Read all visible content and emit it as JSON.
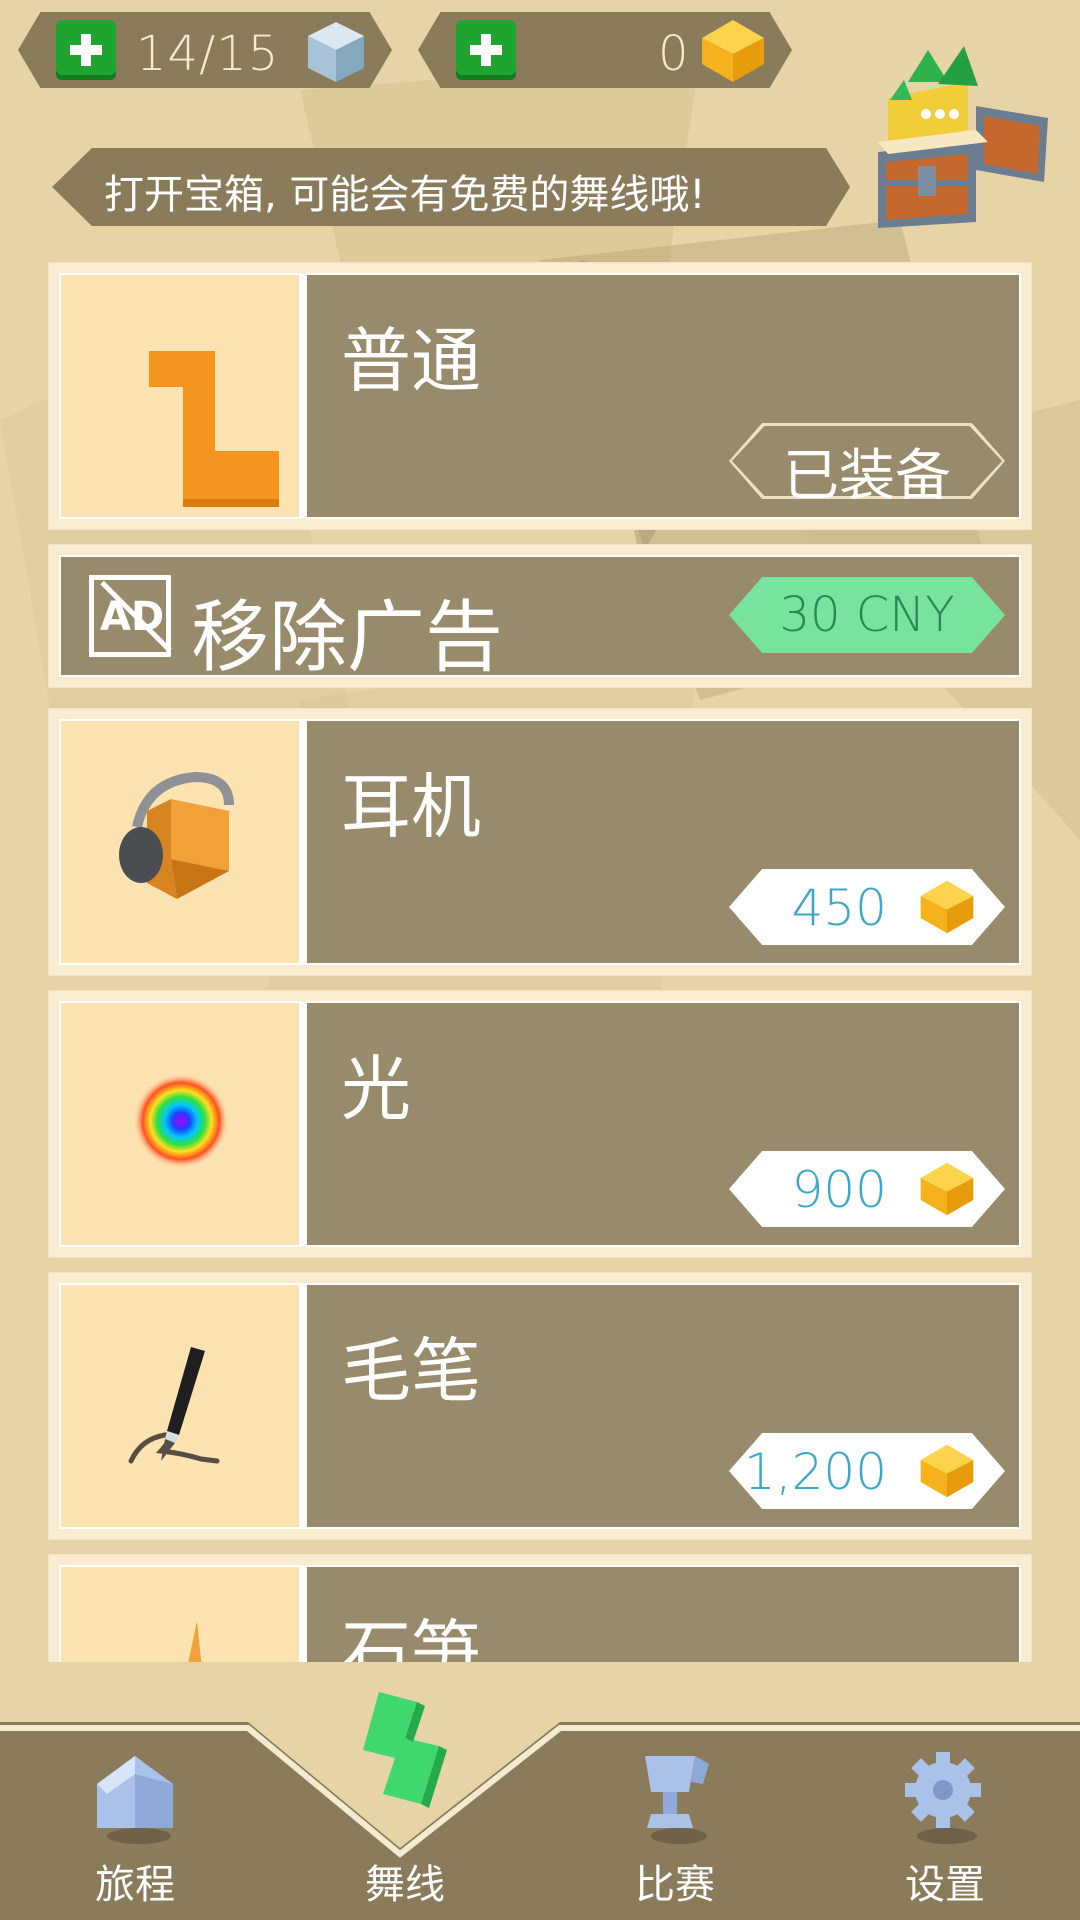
{
  "hud": {
    "lives": {
      "value": "14/15",
      "add_label": "+",
      "icon": "cube-icon"
    },
    "gems": {
      "value": "0",
      "add_label": "+",
      "icon": "gem-icon"
    }
  },
  "banner": {
    "text": "打开宝箱, 可能会有免费的舞线哦!",
    "icon": "treasure-chest-icon"
  },
  "items": [
    {
      "title": "普通",
      "status": "已装备",
      "icon": "orange-line-icon"
    },
    {
      "title": "耳机",
      "price": "450",
      "icon": "headphone-cube-icon"
    },
    {
      "title": "光",
      "price": "900",
      "icon": "rainbow-glow-icon"
    },
    {
      "title": "毛笔",
      "price": "1,200",
      "icon": "brush-icon"
    },
    {
      "title": "石笋",
      "icon": "stalagmite-icon"
    }
  ],
  "remove_ads": {
    "title": "移除广告",
    "price": "30 CNY",
    "icon_text": "AD"
  },
  "nav": [
    {
      "label": "旅程",
      "icon": "house-icon"
    },
    {
      "label": "舞线",
      "icon": "dancing-line-icon",
      "active": true
    },
    {
      "label": "比赛",
      "icon": "trophy-icon"
    },
    {
      "label": "设置",
      "icon": "gear-icon"
    }
  ],
  "colors": {
    "background": "#e6d4a6",
    "panel": "#988b6b",
    "accent_green": "#77e39f",
    "price_text": "#3ba8c8",
    "gem": "#f5b21c"
  }
}
